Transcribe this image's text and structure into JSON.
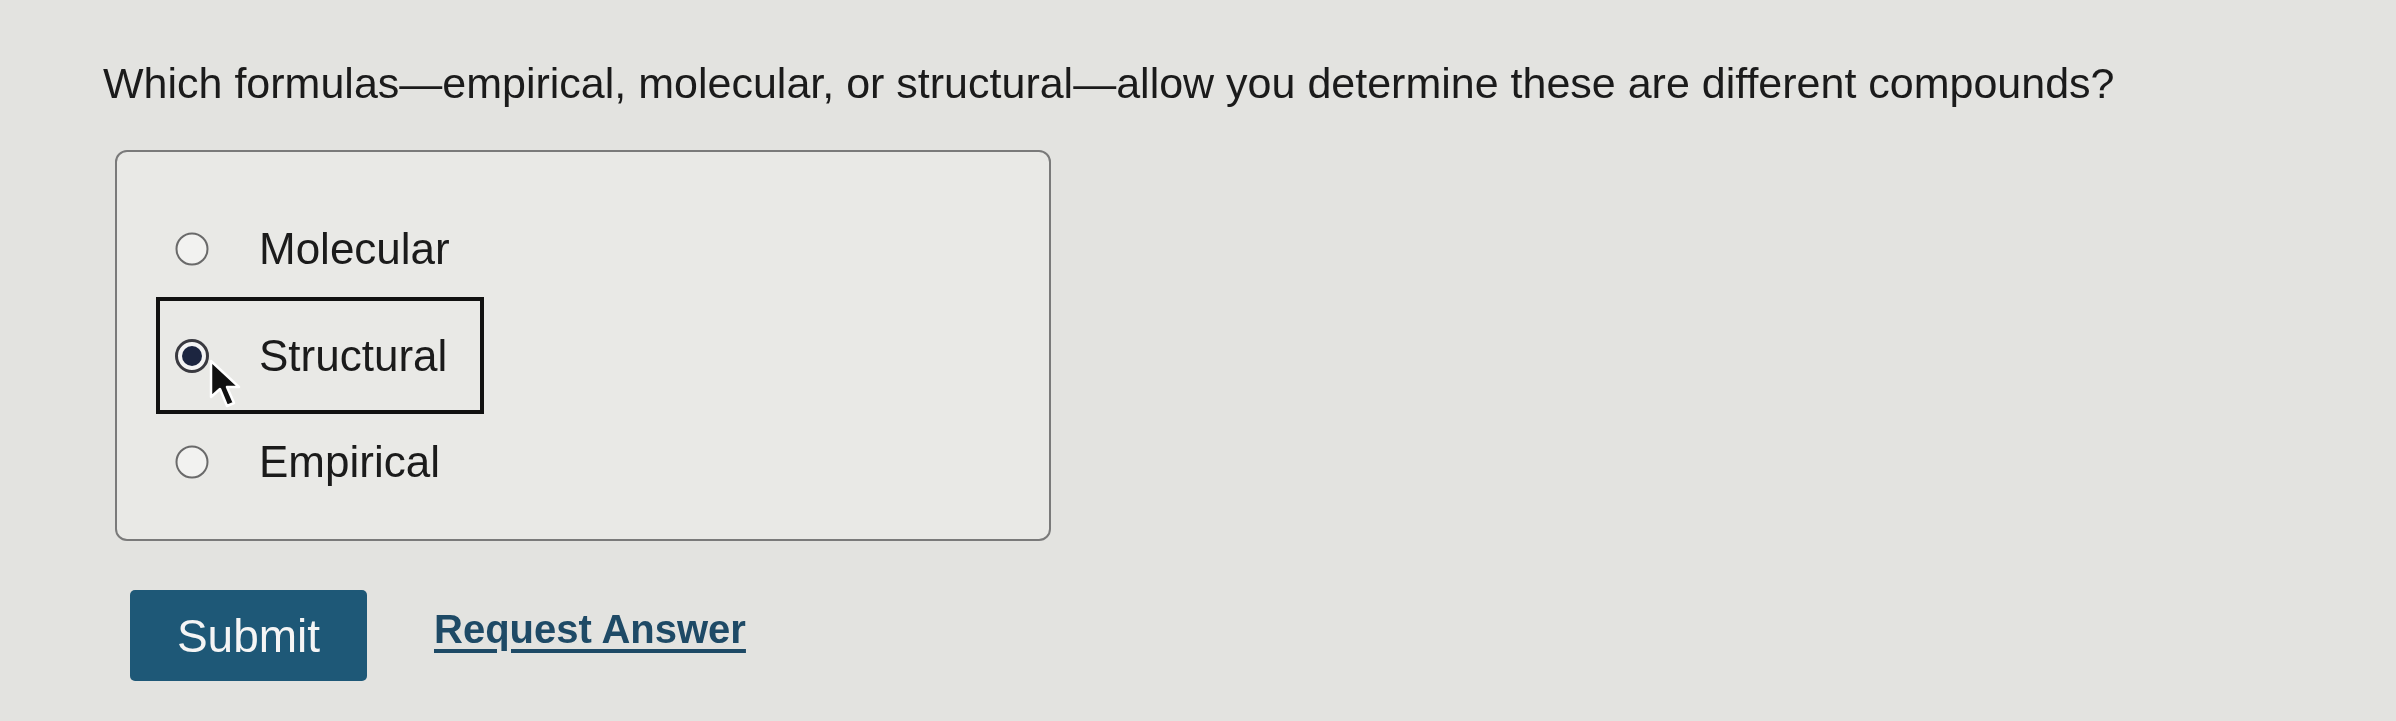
{
  "question": "Which formulas—empirical, molecular, or structural—allow you determine these are different compounds?",
  "options": [
    {
      "label": "Molecular",
      "selected": false,
      "focused": false
    },
    {
      "label": "Structural",
      "selected": true,
      "focused": true
    },
    {
      "label": "Empirical",
      "selected": false,
      "focused": false
    }
  ],
  "actions": {
    "submit": "Submit",
    "request_answer": "Request Answer"
  }
}
